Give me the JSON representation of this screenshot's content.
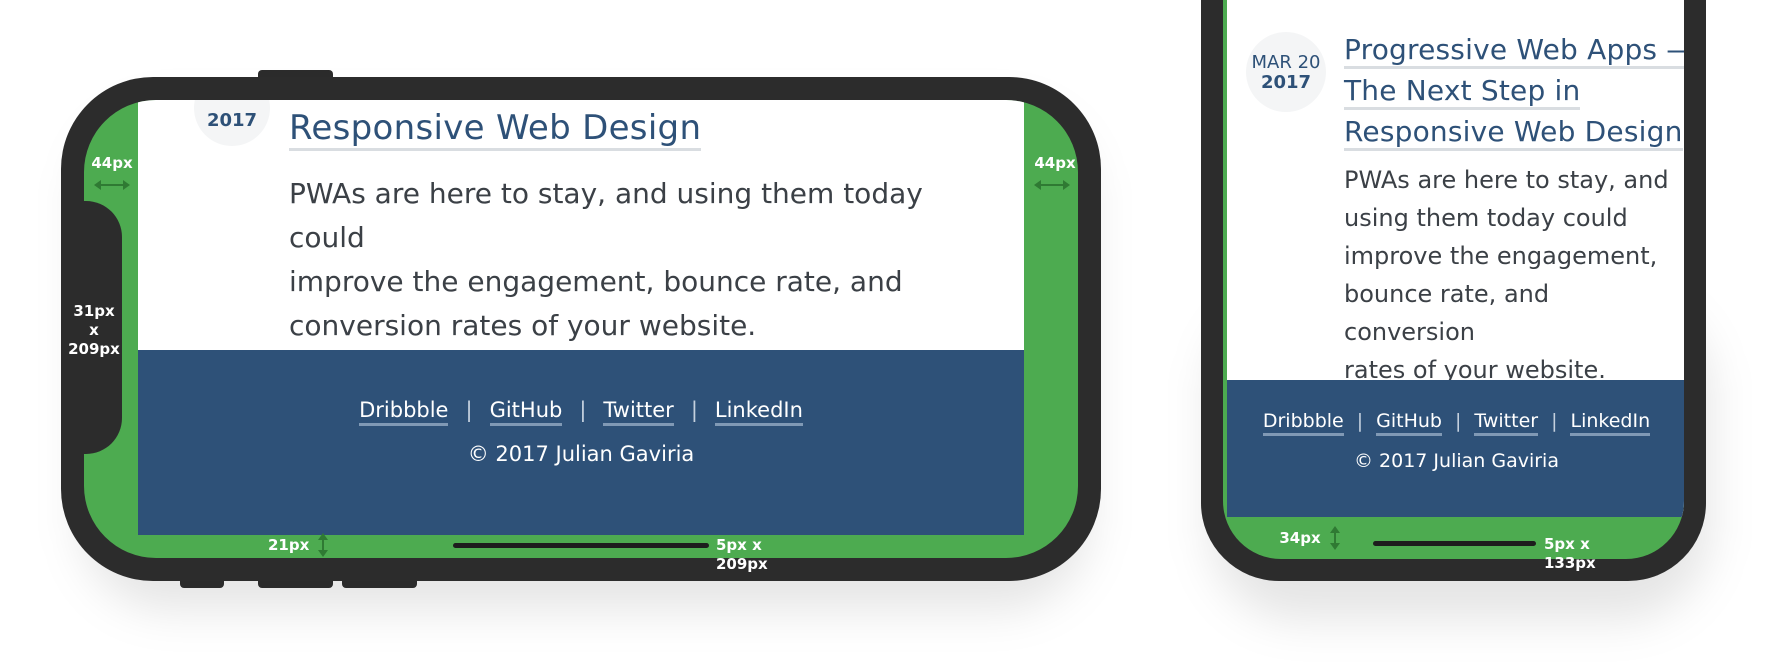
{
  "post": {
    "date_month": "MAR 20",
    "date_year": "2017",
    "title_lines": [
      "Progressive Web Apps —",
      "The Next Step in",
      "Responsive Web Design"
    ],
    "title_visible_line_landscape": "Responsive Web Design",
    "excerpt_landscape_lines": [
      "PWAs are here to stay, and using them today could",
      "improve the engagement, bounce rate, and",
      "conversion rates of your website."
    ],
    "excerpt_portrait_lines": [
      "PWAs are here to stay, and",
      "using them today could",
      "improve the engagement,",
      "bounce rate, and conversion",
      "rates of your website."
    ]
  },
  "footer": {
    "links": [
      "Dribbble",
      "GitHub",
      "Twitter",
      "LinkedIn"
    ],
    "separator": "|",
    "copyright": "© 2017 Julian Gaviria"
  },
  "annotations": {
    "landscape": {
      "left_inset": "44px",
      "right_inset": "44px",
      "notch_line1": "31px",
      "notch_line2": "x",
      "notch_line3": "209px",
      "bottom_inset": "21px",
      "home_indicator": "5px x 209px"
    },
    "portrait": {
      "bottom_inset": "34px",
      "home_indicator": "5px x 133px"
    }
  },
  "colors": {
    "safe_area": "#4dab50",
    "device": "#2c2c2c",
    "footer_bg": "#2e5178",
    "accent_text": "#2e5178"
  }
}
